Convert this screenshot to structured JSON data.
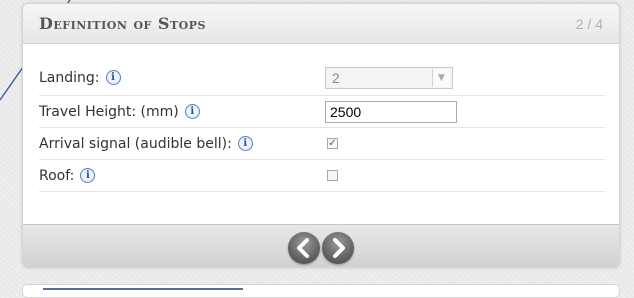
{
  "panel": {
    "title": "Definition of Stops",
    "step": "2 / 4"
  },
  "fields": {
    "landing": {
      "label": "Landing:",
      "value": "2"
    },
    "travel_height": {
      "label": "Travel Height: (mm)",
      "value": "2500"
    },
    "arrival_signal": {
      "label": "Arrival signal (audible bell):",
      "checked": true
    },
    "roof": {
      "label": "Roof:",
      "checked": false
    }
  },
  "icons": {
    "info": "info-icon",
    "info_glyph": "i",
    "prev": "chevron-left-icon",
    "next": "chevron-right-icon"
  },
  "colors": {
    "panel_bg": "#ffffff",
    "footer_bg": "#d9d9d9",
    "info_blue": "#264f9a",
    "nav_button": "#5a5a5a"
  }
}
